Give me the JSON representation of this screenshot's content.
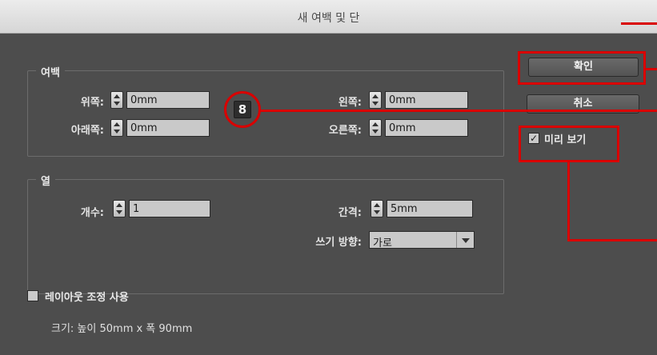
{
  "window": {
    "title": "새 여백 및 단"
  },
  "margins": {
    "group_label": "여백",
    "top_label": "위쪽:",
    "top_value": "0mm",
    "bottom_label": "아래쪽:",
    "bottom_value": "0mm",
    "left_label": "왼쪽:",
    "left_value": "0mm",
    "right_label": "오른쪽:",
    "right_value": "0mm",
    "link_glyph": "8"
  },
  "columns": {
    "group_label": "열",
    "count_label": "개수:",
    "count_value": "1",
    "gutter_label": "간격:",
    "gutter_value": "5mm",
    "direction_label": "쓰기 방향:",
    "direction_value": "가로"
  },
  "buttons": {
    "ok_label": "확인",
    "cancel_label": "취소"
  },
  "preview": {
    "label": "미리 보기",
    "checked": true,
    "check_glyph": "✓"
  },
  "layout_adjust": {
    "label": "레이아웃 조정 사용",
    "checked": false
  },
  "size_info": "크기: 높이 50mm x 폭 90mm",
  "colors": {
    "annotation": "#d90000",
    "dialog_bg": "#4d4d4d"
  }
}
